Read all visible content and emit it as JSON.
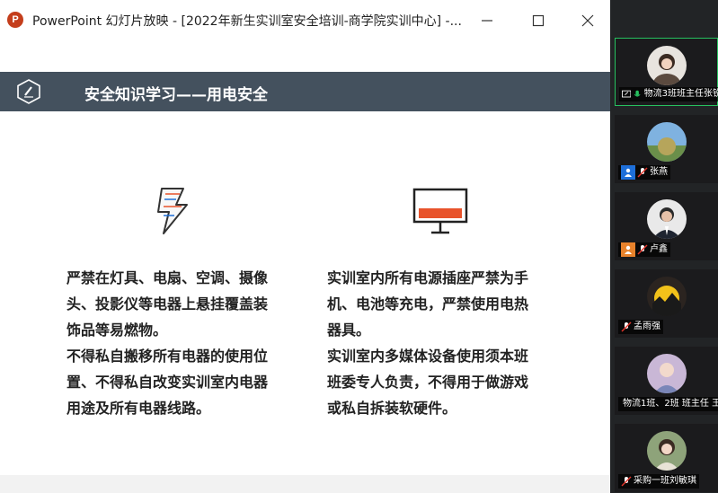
{
  "window": {
    "app_icon_letter": "P",
    "title": "PowerPoint 幻灯片放映 - [2022年新生实训室安全培训-商学院实训中心] -..."
  },
  "slide": {
    "header_title": "安全知识学习——用电安全",
    "left_column": [
      "严禁在灯具、电扇、空调、摄像",
      "头、投影仪等电器上悬挂覆盖装",
      "饰品等易燃物。",
      "不得私自搬移所有电器的使用位",
      "置、不得私自改变实训室内电器",
      "用途及所有电器线路。"
    ],
    "right_column": [
      "实训室内所有电源插座严禁为手",
      "机、电池等充电，严禁使用电热",
      "器具。",
      "实训室内多媒体设备使用须本班",
      "班委专人负责，不得用于做游戏",
      "或私自拆装软硬件。"
    ]
  },
  "participants": [
    {
      "name": "物流3班班主任张锐",
      "icon": "screen-share-icon",
      "mic": "mic-on",
      "active": true
    },
    {
      "name": "张燕",
      "icon": "person-icon",
      "mic": "mic-muted",
      "active": false
    },
    {
      "name": "卢鑫",
      "icon": "person-icon",
      "mic": "mic-muted",
      "active": false
    },
    {
      "name": "孟雨强",
      "icon": "",
      "mic": "mic-muted",
      "active": false
    },
    {
      "name": "物流1班、2班 班主任 王",
      "icon": "",
      "mic": "mic-muted",
      "active": false
    },
    {
      "name": "采购一班刘敏琪",
      "icon": "",
      "mic": "mic-muted",
      "active": false
    }
  ],
  "colors": {
    "header_band": "#44515e",
    "active_border": "#27c15f",
    "accent_orange": "#e8532b",
    "accent_blue": "#1e6fd9"
  }
}
